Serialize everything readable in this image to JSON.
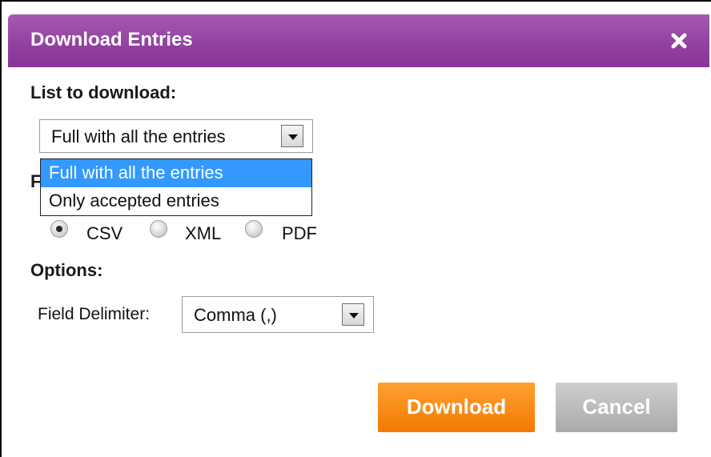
{
  "dialog": {
    "title": "Download Entries",
    "close_icon": "close-icon"
  },
  "list": {
    "label": "List to download:",
    "selected": "Full with all the entries",
    "options": [
      "Full with all the entries",
      "Only accepted entries"
    ],
    "highlighted_option": "Full with all the entries"
  },
  "format": {
    "label_partial": "F",
    "options": [
      {
        "label": "CSV",
        "checked": true
      },
      {
        "label": "XML",
        "checked": false
      },
      {
        "label": "PDF",
        "checked": false
      }
    ]
  },
  "options": {
    "label": "Options:",
    "delimiter_label": "Field Delimiter:",
    "delimiter_value": "Comma (,)"
  },
  "buttons": {
    "download": "Download",
    "cancel": "Cancel"
  },
  "colors": {
    "titlebar": "#91409f",
    "download_button": "#f47a00",
    "cancel_button": "#a9a9a9",
    "highlight": "#3399ff"
  }
}
